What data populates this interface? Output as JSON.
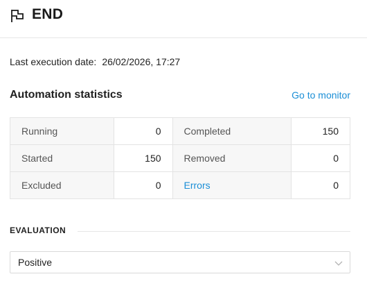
{
  "header": {
    "title": "END",
    "icon": "flag-icon"
  },
  "last_execution": {
    "label": "Last execution date:",
    "value": "26/02/2026, 17:27"
  },
  "statistics": {
    "title": "Automation statistics",
    "monitor_link": "Go to monitor",
    "rows": [
      {
        "left_label": "Running",
        "left_value": "0",
        "right_label": "Completed",
        "right_value": "150"
      },
      {
        "left_label": "Started",
        "left_value": "150",
        "right_label": "Removed",
        "right_value": "0"
      },
      {
        "left_label": "Excluded",
        "left_value": "0",
        "right_label": "Errors",
        "right_value": "0"
      }
    ]
  },
  "evaluation": {
    "label": "EVALUATION",
    "selected": "Positive",
    "icon": "chevron-down-icon"
  },
  "colors": {
    "link": "#1a8ed6",
    "label_bg": "#f7f7f7",
    "border": "#e3e3e3"
  }
}
